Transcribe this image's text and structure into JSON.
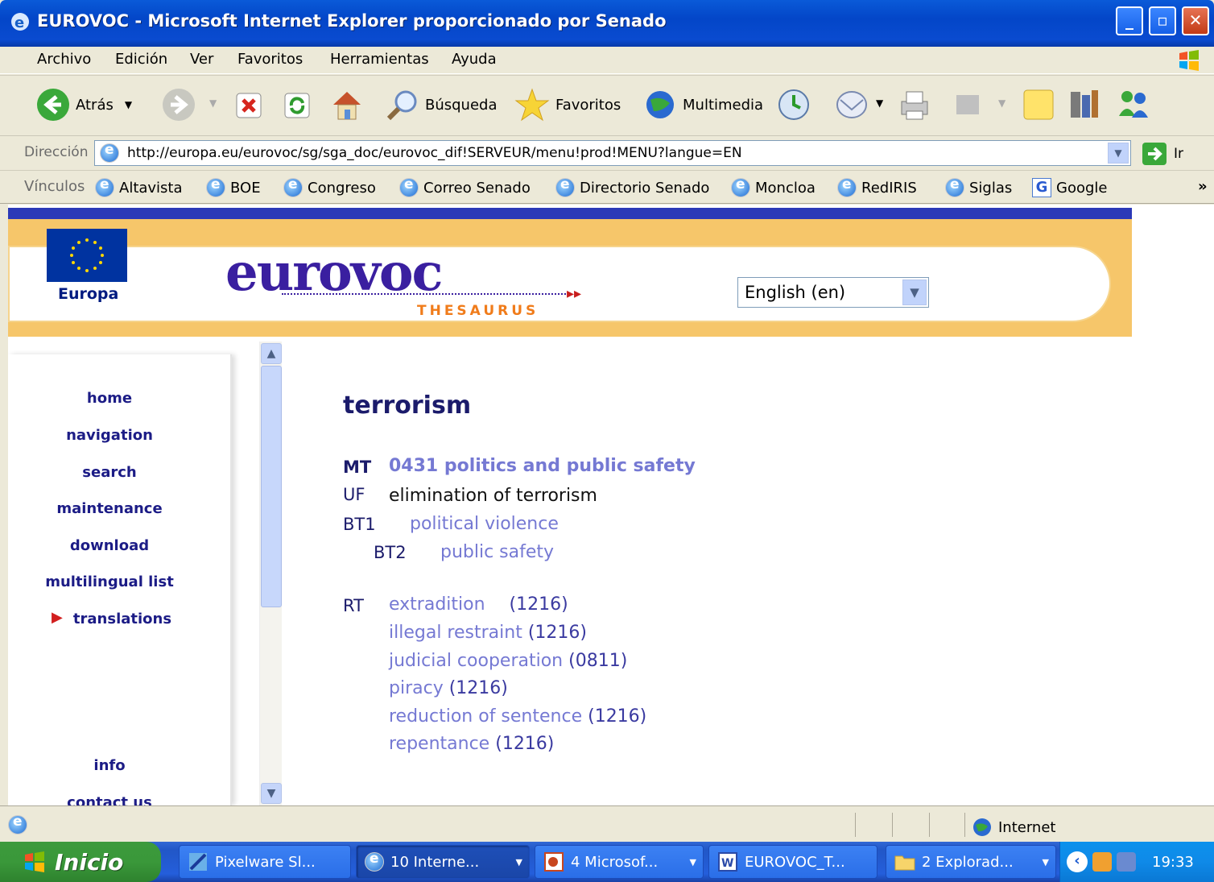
{
  "window": {
    "title": "EUROVOC - Microsoft Internet Explorer proporcionado por Senado"
  },
  "menubar": [
    "Archivo",
    "Edición",
    "Ver",
    "Favoritos",
    "Herramientas",
    "Ayuda"
  ],
  "toolbar": {
    "back_label": "Atrás",
    "search_label": "Búsqueda",
    "favorites_label": "Favoritos",
    "media_label": "Multimedia"
  },
  "address": {
    "label": "Dirección",
    "url": "http://europa.eu/eurovoc/sg/sga_doc/eurovoc_dif!SERVEUR/menu!prod!MENU?langue=EN",
    "go_label": "Ir"
  },
  "links": {
    "label": "Vínculos",
    "items": [
      "Altavista",
      "BOE",
      "Congreso",
      "Correo Senado",
      "Directorio Senado",
      "Moncloa",
      "RedIRIS",
      "Siglas",
      "Google"
    ],
    "more": "»"
  },
  "page": {
    "europa_label": "Europa",
    "logo_text": "eurovoc",
    "logo_subtitle": "THESAURUS",
    "language_selected": "English (en)",
    "nav": [
      "home",
      "navigation",
      "search",
      "maintenance",
      "download",
      "multilingual list",
      "translations"
    ],
    "nav_bottom": [
      "info",
      "contact us"
    ],
    "term": "terrorism",
    "mt_label": "MT",
    "mt_value": "0431 politics and public safety",
    "uf_label": "UF",
    "uf_value": "elimination of terrorism",
    "bt1_label": "BT1",
    "bt1_value": "political violence",
    "bt2_label": "BT2",
    "bt2_value": "public safety",
    "rt_label": "RT",
    "related": [
      {
        "term": "extradition",
        "code": "(1216)"
      },
      {
        "term": "illegal restraint",
        "code": "(1216)"
      },
      {
        "term": "judicial cooperation",
        "code": "(0811)"
      },
      {
        "term": "piracy",
        "code": "(1216)"
      },
      {
        "term": "reduction of sentence",
        "code": "(1216)"
      },
      {
        "term": "repentance",
        "code": "(1216)"
      }
    ]
  },
  "statusbar": {
    "zone": "Internet"
  },
  "taskbar": {
    "start_label": "Inicio",
    "tasks": [
      "Pixelware Sl...",
      "10 Interne...",
      "4 Microsof...",
      "EUROVOC_T...",
      "2 Explorad..."
    ],
    "clock": "19:33"
  },
  "colors": {
    "titlebar": "#0346c8",
    "header_orange": "#f6c66a",
    "nav_blue": "#1c1c86",
    "link_purple": "#7579d3",
    "taskbar": "#245edb",
    "start_green": "#3a983a"
  }
}
